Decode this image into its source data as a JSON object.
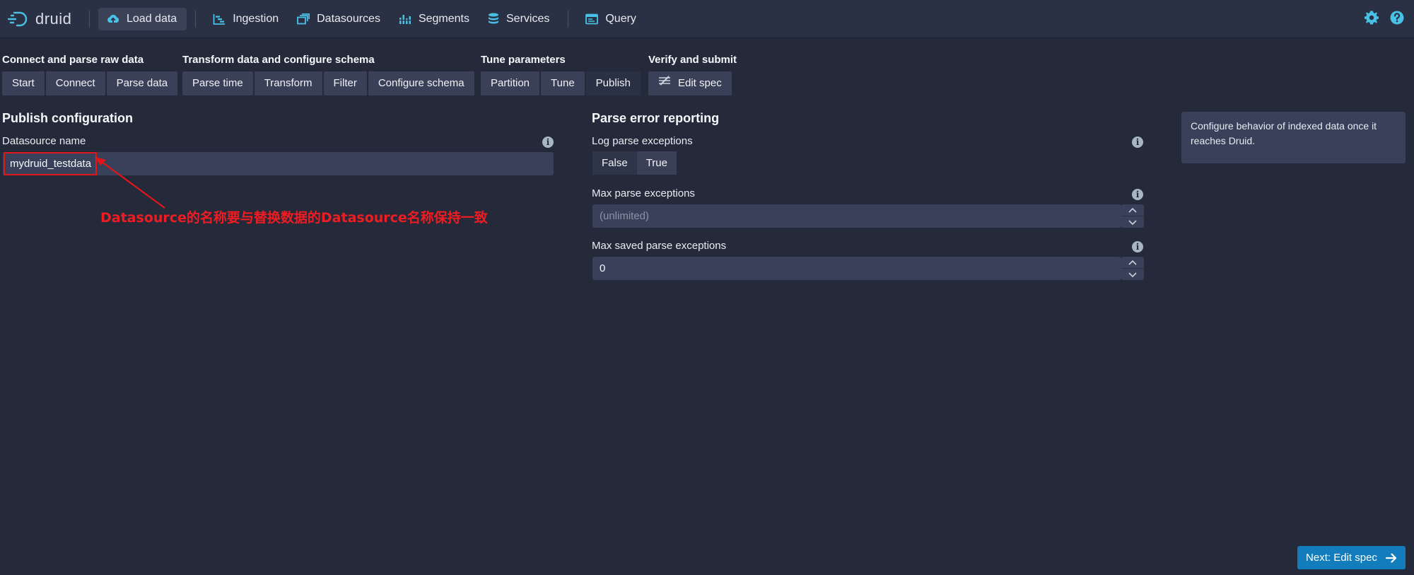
{
  "navbar": {
    "brand": "druid",
    "items": [
      {
        "label": "Load data"
      },
      {
        "label": "Ingestion"
      },
      {
        "label": "Datasources"
      },
      {
        "label": "Segments"
      },
      {
        "label": "Services"
      },
      {
        "label": "Query"
      }
    ]
  },
  "steps": {
    "groups": [
      {
        "title": "Connect and parse raw data",
        "buttons": [
          "Start",
          "Connect",
          "Parse data"
        ]
      },
      {
        "title": "Transform data and configure schema",
        "buttons": [
          "Parse time",
          "Transform",
          "Filter",
          "Configure schema"
        ]
      },
      {
        "title": "Tune parameters",
        "buttons": [
          "Partition",
          "Tune",
          "Publish"
        ]
      },
      {
        "title": "Verify and submit",
        "buttons": [
          "Edit spec"
        ]
      }
    ],
    "current": "Publish"
  },
  "publish": {
    "title": "Publish configuration",
    "datasource_label": "Datasource name",
    "datasource_value": "mydruid_testdata"
  },
  "parse_errors": {
    "title": "Parse error reporting",
    "log_label": "Log parse exceptions",
    "log_options": [
      "False",
      "True"
    ],
    "log_selected": "True",
    "max_label": "Max parse exceptions",
    "max_placeholder": "(unlimited)",
    "max_saved_label": "Max saved parse exceptions",
    "max_saved_value": "0"
  },
  "info_panel": {
    "text": "Configure behavior of indexed data once it reaches Druid."
  },
  "annotation": {
    "text": "Datasource的名称要与替换数据的Datasource名称保持一致",
    "color": "#f01c21"
  },
  "footer": {
    "next_label": "Next: Edit spec"
  },
  "colors": {
    "background": "#252a3b",
    "navbar": "#2b3144",
    "accent": "#137cbd",
    "icon_cyan": "#48c1e5"
  }
}
